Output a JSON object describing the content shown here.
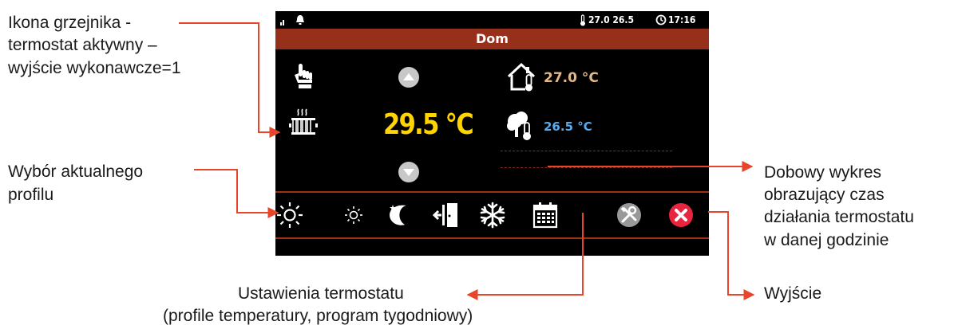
{
  "annotations": {
    "radiator_line1": "Ikona grzejnika -",
    "radiator_line2": "termostat aktywny –",
    "radiator_line3": "wyjście wykonawcze=1",
    "profile_line1": "Wybór aktualnego",
    "profile_line2": "profilu",
    "chart_line1": "Dobowy wykres",
    "chart_line2": "obrazujący czas",
    "chart_line3": "działania termostatu",
    "chart_line4": "w danej godzinie",
    "settings_line1": "Ustawienia termostatu",
    "settings_line2": "(profile temperatury, program tygodniowy)",
    "exit": "Wyjście"
  },
  "device": {
    "status": {
      "thermo_readout": "27.0 26.5",
      "clock": "17:16"
    },
    "title": "Dom",
    "setpoint": "29.5 °C",
    "indoor_temp": "27.0 °C",
    "outdoor_temp": "26.5 °C",
    "icons": {
      "signal": "signal-icon",
      "alarm": "bell-icon",
      "hand": "manual-hand-icon",
      "radiator": "radiator-icon",
      "up": "arrow-up-button",
      "down": "arrow-down-button",
      "house_temp": "house-thermometer-icon",
      "outdoor": "tree-thermometer-icon"
    },
    "toolbar": [
      "sun-large-icon",
      "sun-small-icon",
      "moon-stars-icon",
      "door-exit-icon",
      "snowflake-icon",
      "calendar-icon",
      "tools-icon",
      "close-icon"
    ]
  },
  "colors": {
    "accent_red": "#97301a",
    "setpoint_yellow": "#ffd400",
    "indoor_tan": "#e3b98a",
    "outdoor_blue": "#5aaaf0",
    "arrow_orange": "#e8452a",
    "close_red": "#e8243f"
  }
}
